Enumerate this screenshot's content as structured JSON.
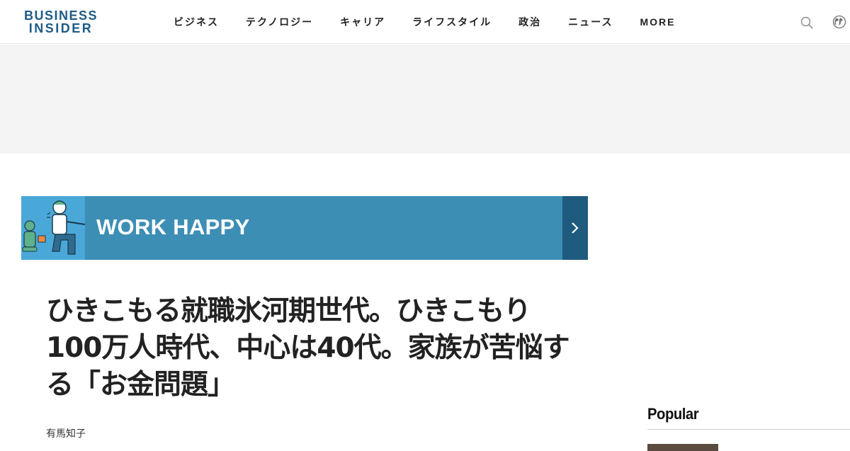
{
  "logo": {
    "line1": "BUSINESS",
    "line2": "INSIDER"
  },
  "nav": {
    "items": [
      "ビジネス",
      "テクノロジー",
      "キャリア",
      "ライフスタイル",
      "政治",
      "ニュース",
      "MORE"
    ]
  },
  "icons": {
    "search": "search-icon",
    "globe": "globe-icon",
    "banner_arrow": "chevron-right-icon"
  },
  "banner": {
    "title": "WORK HAPPY"
  },
  "article": {
    "headline": "ひきこもる就職氷河期世代。ひきこもり100万人時代、中心は40代。家族が苦悩する「お金問題」",
    "author": "有馬知子"
  },
  "sidebar": {
    "popular_title": "Popular"
  },
  "colors": {
    "brand": "#1d5b86",
    "banner_bg": "#3d8eb5",
    "banner_arrow_bg": "#1f5b7e",
    "ad_bg": "#f4f4f4",
    "accent_red": "#e4262e"
  }
}
